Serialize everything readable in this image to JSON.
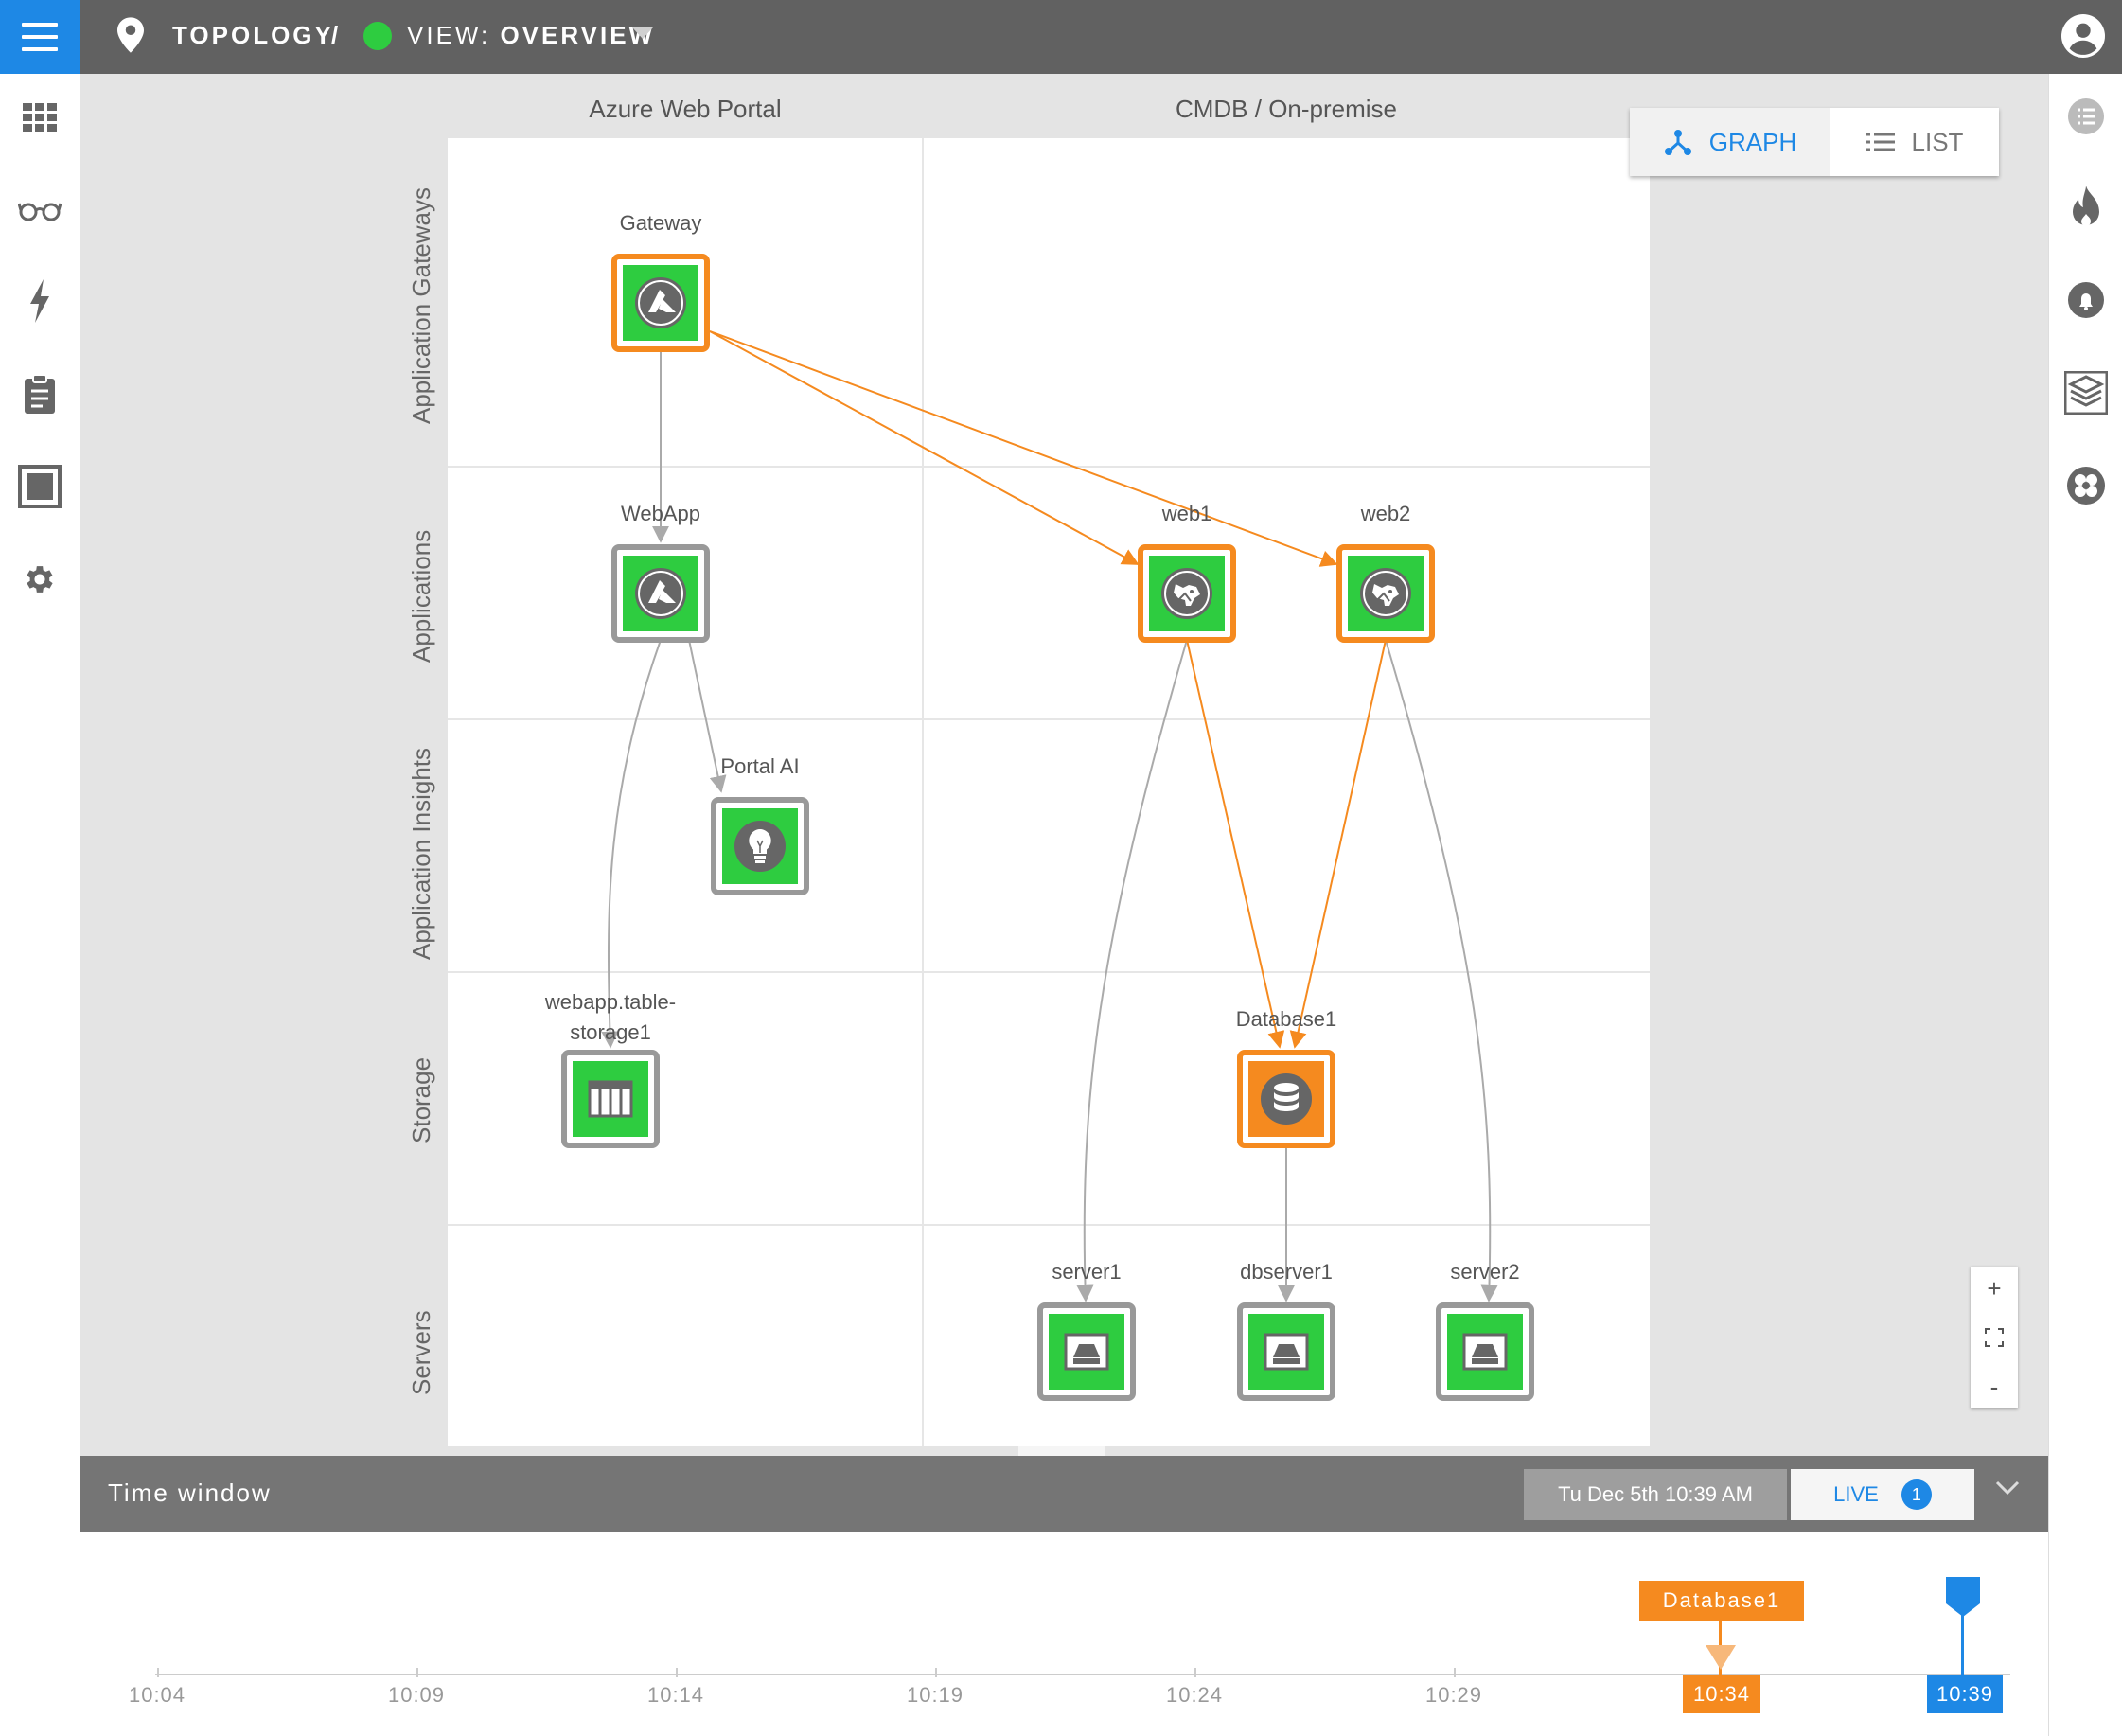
{
  "header": {
    "breadcrumb_topology": "TOPOLOGY",
    "breadcrumb_separator": "/",
    "view_prefix": "VIEW: ",
    "view_name": "OVERVIEW",
    "status_color": "#2ecc40"
  },
  "left_nav": [
    "dashboard-icon",
    "glasses-icon",
    "lightning-icon",
    "clipboard-icon",
    "square-icon",
    "gear-icon"
  ],
  "right_nav": [
    "list-circle-icon",
    "flame-icon",
    "bell-icon",
    "layers-icon",
    "cluster-icon"
  ],
  "view_toggle": {
    "graph_label": "GRAPH",
    "list_label": "LIST",
    "active": "graph"
  },
  "columns": [
    "Azure Web Portal",
    "CMDB / On-premise"
  ],
  "rows": [
    "Application Gateways",
    "Applications",
    "Application Insights",
    "Storage",
    "Servers"
  ],
  "nodes": {
    "gateway": "Gateway",
    "webapp": "WebApp",
    "portal_ai": "Portal AI",
    "web1": "web1",
    "web2": "web2",
    "storage_line1": "webapp.table-",
    "storage_line2": "storage1",
    "database1": "Database1",
    "server1": "server1",
    "dbserver1": "dbserver1",
    "server2": "server2"
  },
  "zoom": {
    "plus": "+",
    "minus": "-"
  },
  "time_window": {
    "title": "Time window",
    "date": "Tu Dec 5th 10:39 AM",
    "live_label": "LIVE",
    "live_count": "1",
    "ticks": [
      "10:04",
      "10:09",
      "10:14",
      "10:19",
      "10:24",
      "10:29"
    ],
    "event_label": "Database1",
    "event_time": "10:34",
    "current_time": "10:39"
  },
  "colors": {
    "accent": "#1e88e5",
    "ok": "#2ecc40",
    "warning": "#f58a1f",
    "topbar": "#616161"
  }
}
